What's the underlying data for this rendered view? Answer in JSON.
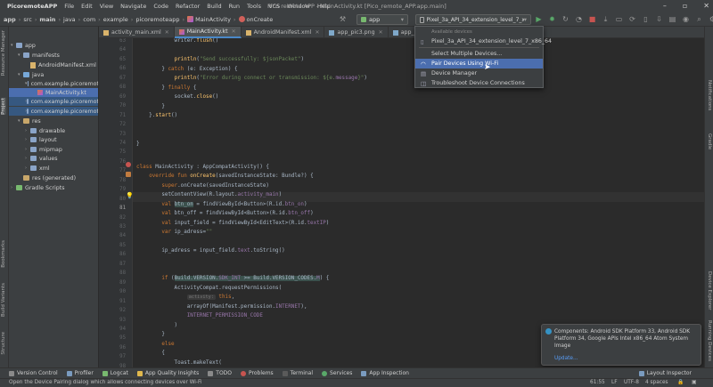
{
  "menu": {
    "app_name": "PicoremoteAPP",
    "items": [
      "File",
      "Edit",
      "View",
      "Navigate",
      "Code",
      "Refactor",
      "Build",
      "Run",
      "Tools",
      "VCS",
      "Window",
      "Help"
    ],
    "window_title": "Pico remote APP - MainActivity.kt [Pico_remote_APP.app.main]"
  },
  "breadcrumb": [
    "app",
    "src",
    "main",
    "java",
    "com",
    "example",
    "picoremoteapp",
    "MainActivity",
    "onCreate"
  ],
  "run_config": "app",
  "device": "Pixel_3a_API_34_extension_level_7_x86_64",
  "tabs": [
    {
      "label": "activity_main.xml",
      "active": false
    },
    {
      "label": "MainActivity.kt",
      "active": true
    },
    {
      "label": "AndroidManifest.xml",
      "active": false
    },
    {
      "label": "app_pic3.png",
      "active": false
    },
    {
      "label": "app_pic_no_frame.png",
      "active": false
    }
  ],
  "project_tree": [
    {
      "label": "app",
      "depth": 0,
      "type": "module",
      "arrow": "▾"
    },
    {
      "label": "manifests",
      "depth": 1,
      "type": "folder",
      "arrow": "▾"
    },
    {
      "label": "AndroidManifest.xml",
      "depth": 2,
      "type": "xml",
      "arrow": ""
    },
    {
      "label": "java",
      "depth": 1,
      "type": "java",
      "arrow": "▾"
    },
    {
      "label": "com.example.picoremot",
      "depth": 2,
      "type": "folder",
      "arrow": "▾"
    },
    {
      "label": "MainActivity.kt",
      "depth": 3,
      "type": "kt",
      "arrow": ""
    },
    {
      "label": "com.example.picoremot",
      "depth": 2,
      "type": "folder",
      "arrow": "›"
    },
    {
      "label": "com.example.picoremot",
      "depth": 2,
      "type": "folder",
      "arrow": "›"
    },
    {
      "label": "res",
      "depth": 1,
      "type": "res",
      "arrow": "▾"
    },
    {
      "label": "drawable",
      "depth": 2,
      "type": "folder",
      "arrow": "›"
    },
    {
      "label": "layout",
      "depth": 2,
      "type": "folder",
      "arrow": "›"
    },
    {
      "label": "mipmap",
      "depth": 2,
      "type": "folder",
      "arrow": "›"
    },
    {
      "label": "values",
      "depth": 2,
      "type": "folder",
      "arrow": "›"
    },
    {
      "label": "xml",
      "depth": 2,
      "type": "folder",
      "arrow": "›"
    },
    {
      "label": "res (generated)",
      "depth": 1,
      "type": "res",
      "arrow": ""
    },
    {
      "label": "Gradle Scripts",
      "depth": 0,
      "type": "gradle",
      "arrow": "›"
    }
  ],
  "left_tools": [
    "Resource Manager",
    "Project",
    "Bookmarks",
    "Build Variants",
    "Structure"
  ],
  "right_tools": [
    "Notifications",
    "Gradle",
    "Device Explorer",
    "Running Devices"
  ],
  "line_numbers": [
    "63",
    "64",
    "65",
    "66",
    "67",
    "68",
    "69",
    "70",
    "71",
    "72",
    "73",
    "74",
    "75",
    "76",
    "77",
    "78",
    "79",
    "80",
    "81",
    "82",
    "83",
    "84",
    "85",
    "86",
    "87",
    "88",
    "89",
    "90",
    "91",
    "92",
    "93",
    "94",
    "95",
    "96",
    "97",
    "98",
    "99"
  ],
  "dropdown": {
    "header": "Available devices",
    "items": [
      "Pixel_3a_API_34_extension_level_7_x86_64",
      "Select Multiple Devices...",
      "Pair Devices Using Wi-Fi",
      "Device Manager",
      "Troubleshoot Device Connections"
    ],
    "selected_index": 2
  },
  "notification": {
    "text": "Components: Android SDK Platform 33, Android SDK Platform 34, Google APIs Intel x86_64 Atom System Image",
    "link": "Update..."
  },
  "bottom_tools": [
    "Version Control",
    "Profiler",
    "Logcat",
    "App Quality Insights",
    "TODO",
    "Problems",
    "Terminal",
    "Services",
    "App Inspection"
  ],
  "layout_inspector": "Layout Inspector",
  "status": {
    "message": "Open the Device Pairing dialog which allows connecting devices over Wi-Fi",
    "position": "61:55",
    "line_sep": "LF",
    "encoding": "UTF-8",
    "indent": "4 spaces"
  },
  "colors": {
    "accent": "#4b6eaf",
    "keyword": "#cc7832",
    "string": "#6a8759",
    "function": "#ffc66d",
    "field": "#9876aa",
    "link": "#589df6"
  }
}
